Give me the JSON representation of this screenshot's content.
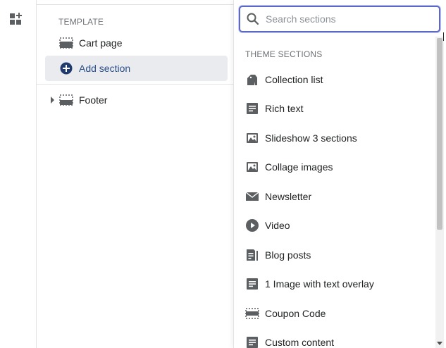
{
  "sidebar": {
    "template_label": "TEMPLATE",
    "cart_page_label": "Cart page",
    "add_section_label": "Add section",
    "footer_label": "Footer"
  },
  "dropdown": {
    "search_placeholder": "Search sections",
    "section_heading": "THEME SECTIONS",
    "items": [
      {
        "label": "Collection list",
        "icon": "collection-icon"
      },
      {
        "label": "Rich text",
        "icon": "text-block-icon"
      },
      {
        "label": "Slideshow 3 sections",
        "icon": "image-icon"
      },
      {
        "label": "Collage images",
        "icon": "image-icon"
      },
      {
        "label": "Newsletter",
        "icon": "envelope-icon"
      },
      {
        "label": "Video",
        "icon": "play-icon"
      },
      {
        "label": "Blog posts",
        "icon": "blog-icon"
      },
      {
        "label": "1 Image with text overlay",
        "icon": "text-block-icon"
      },
      {
        "label": "Coupon Code",
        "icon": "dashed-section-icon"
      },
      {
        "label": "Custom content",
        "icon": "text-block-icon"
      }
    ]
  },
  "colors": {
    "accent": "#5c6ac4",
    "selected_row_bg": "#e9ebee",
    "icon": "#5c5f62",
    "add_section_icon": "#1f3a6e"
  }
}
